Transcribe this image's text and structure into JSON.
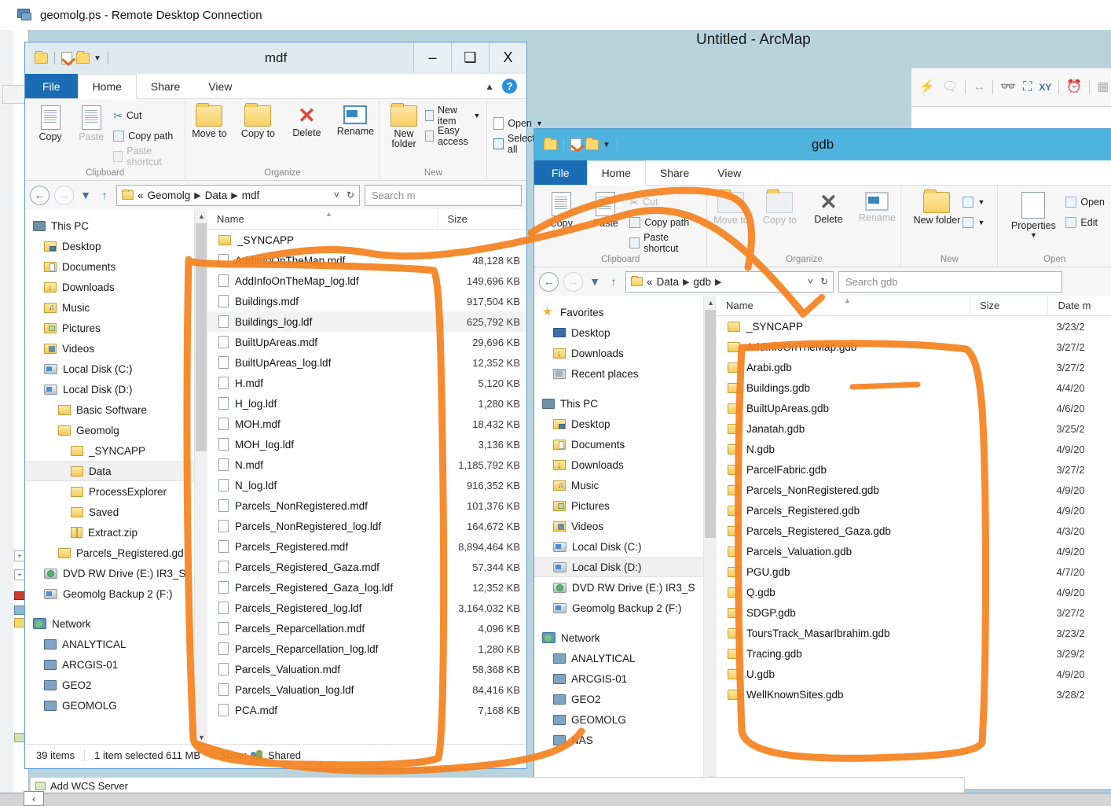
{
  "rdp": {
    "title": "geomolg.ps - Remote Desktop Connection",
    "icon": "remote-desktop-icon"
  },
  "arcmap": {
    "title": "Untitled - ArcMap",
    "bottom_item": "Add WCS Server",
    "toolbar_icons": [
      "lightning-icon",
      "callout-icon",
      "measure-icon",
      "binoculars-icon",
      "identify-icon",
      "xy-icon",
      "time-icon",
      "catalog-icon"
    ]
  },
  "window_controls": {
    "minimize": "–",
    "maximize": "❑",
    "close": "X"
  },
  "accent": {
    "active_title": "#4fb3e0",
    "inactive_title": "#dfe9ee",
    "file_tab": "#1c6cb5",
    "annotation": "#f58220"
  },
  "windows": [
    {
      "id": "mdf",
      "title": "mdf",
      "active": false,
      "tabs": [
        "File",
        "Home",
        "Share",
        "View"
      ],
      "selected_tab": "Home",
      "ribbon": {
        "groups": [
          {
            "label": "Clipboard",
            "big": [
              {
                "label": "Copy",
                "icon": "copy-icon",
                "disabled": false
              },
              {
                "label": "Paste",
                "icon": "paste-icon",
                "disabled": true
              }
            ],
            "small": [
              {
                "label": "Cut",
                "icon": "cut-icon",
                "disabled": false
              },
              {
                "label": "Copy path",
                "icon": "copy-path-icon",
                "disabled": false
              },
              {
                "label": "Paste shortcut",
                "icon": "paste-shortcut-icon",
                "disabled": true
              }
            ]
          },
          {
            "label": "Organize",
            "big": [
              {
                "label": "Move to",
                "icon": "move-to-icon",
                "disabled": false,
                "dropdown": true
              },
              {
                "label": "Copy to",
                "icon": "copy-to-icon",
                "disabled": false,
                "dropdown": true
              },
              {
                "label": "Delete",
                "icon": "delete-icon",
                "disabled": false,
                "dropdown": true
              },
              {
                "label": "Rename",
                "icon": "rename-icon",
                "disabled": false
              }
            ],
            "small": []
          },
          {
            "label": "New",
            "big": [
              {
                "label": "New folder",
                "icon": "new-folder-icon",
                "disabled": false
              }
            ],
            "small": [
              {
                "label": "New item",
                "icon": "new-item-icon",
                "disabled": false,
                "dropdown": true
              },
              {
                "label": "Easy access",
                "icon": "easy-access-icon",
                "disabled": false,
                "dropdown": true
              }
            ]
          },
          {
            "label": "",
            "big": [],
            "small": [
              {
                "label": "Open",
                "icon": "open-icon",
                "disabled": false,
                "dropdown": true
              },
              {
                "label": "Select all",
                "icon": "select-all-icon",
                "disabled": false
              }
            ]
          }
        ]
      },
      "address": {
        "crumbs": [
          "«",
          "Geomolg",
          "Data",
          "mdf"
        ],
        "search_placeholder": "Search m"
      },
      "nav": [
        {
          "label": "This PC",
          "icon": "this-pc-icon",
          "indent": 0
        },
        {
          "label": "Desktop",
          "icon": "desktop-folder-icon",
          "indent": 1
        },
        {
          "label": "Documents",
          "icon": "documents-folder-icon",
          "indent": 1
        },
        {
          "label": "Downloads",
          "icon": "downloads-folder-icon",
          "indent": 1
        },
        {
          "label": "Music",
          "icon": "music-folder-icon",
          "indent": 1
        },
        {
          "label": "Pictures",
          "icon": "pictures-folder-icon",
          "indent": 1
        },
        {
          "label": "Videos",
          "icon": "videos-folder-icon",
          "indent": 1
        },
        {
          "label": "Local Disk (C:)",
          "icon": "drive-icon",
          "indent": 1
        },
        {
          "label": "Local Disk (D:)",
          "icon": "drive-icon",
          "indent": 1
        },
        {
          "label": "Basic Software",
          "icon": "folder-icon",
          "indent": 2
        },
        {
          "label": "Geomolg",
          "icon": "folder-icon",
          "indent": 2
        },
        {
          "label": "_SYNCAPP",
          "icon": "folder-icon",
          "indent": 3
        },
        {
          "label": "Data",
          "icon": "folder-icon",
          "indent": 3,
          "selected": true
        },
        {
          "label": "ProcessExplorer",
          "icon": "folder-icon",
          "indent": 3
        },
        {
          "label": "Saved",
          "icon": "folder-icon",
          "indent": 3
        },
        {
          "label": "Extract.zip",
          "icon": "zip-icon",
          "indent": 3
        },
        {
          "label": "Parcels_Registered.gd",
          "icon": "folder-icon",
          "indent": 2
        },
        {
          "label": "DVD RW Drive (E:) IR3_S",
          "icon": "dvd-drive-icon",
          "indent": 1
        },
        {
          "label": "Geomolg Backup 2 (F:)",
          "icon": "drive-icon",
          "indent": 1
        },
        {
          "label": "",
          "icon": "spacer",
          "indent": 0
        },
        {
          "label": "Network",
          "icon": "network-icon",
          "indent": 0
        },
        {
          "label": "ANALYTICAL",
          "icon": "computer-icon",
          "indent": 1
        },
        {
          "label": "ARCGIS-01",
          "icon": "computer-icon",
          "indent": 1
        },
        {
          "label": "GEO2",
          "icon": "computer-icon",
          "indent": 1
        },
        {
          "label": "GEOMOLG",
          "icon": "computer-icon",
          "indent": 1
        }
      ],
      "columns": [
        "Name",
        "Size"
      ],
      "files": [
        {
          "name": "_SYNCAPP",
          "size": "",
          "icon": "folder-icon"
        },
        {
          "name": "AddInfoOnTheMap.mdf",
          "size": "48,128 KB",
          "icon": "file-icon"
        },
        {
          "name": "AddInfoOnTheMap_log.ldf",
          "size": "149,696 KB",
          "icon": "file-icon"
        },
        {
          "name": "Buildings.mdf",
          "size": "917,504 KB",
          "icon": "file-icon"
        },
        {
          "name": "Buildings_log.ldf",
          "size": "625,792 KB",
          "icon": "file-icon",
          "selected": true
        },
        {
          "name": "BuiltUpAreas.mdf",
          "size": "29,696 KB",
          "icon": "file-icon"
        },
        {
          "name": "BuiltUpAreas_log.ldf",
          "size": "12,352 KB",
          "icon": "file-icon"
        },
        {
          "name": "H.mdf",
          "size": "5,120 KB",
          "icon": "file-icon"
        },
        {
          "name": "H_log.ldf",
          "size": "1,280 KB",
          "icon": "file-icon"
        },
        {
          "name": "MOH.mdf",
          "size": "18,432 KB",
          "icon": "file-icon"
        },
        {
          "name": "MOH_log.ldf",
          "size": "3,136 KB",
          "icon": "file-icon"
        },
        {
          "name": "N.mdf",
          "size": "1,185,792 KB",
          "icon": "file-icon"
        },
        {
          "name": "N_log.ldf",
          "size": "916,352 KB",
          "icon": "file-icon"
        },
        {
          "name": "Parcels_NonRegistered.mdf",
          "size": "101,376 KB",
          "icon": "file-icon"
        },
        {
          "name": "Parcels_NonRegistered_log.ldf",
          "size": "164,672 KB",
          "icon": "file-icon"
        },
        {
          "name": "Parcels_Registered.mdf",
          "size": "8,894,464 KB",
          "icon": "file-icon"
        },
        {
          "name": "Parcels_Registered_Gaza.mdf",
          "size": "57,344 KB",
          "icon": "file-icon"
        },
        {
          "name": "Parcels_Registered_Gaza_log.ldf",
          "size": "12,352 KB",
          "icon": "file-icon"
        },
        {
          "name": "Parcels_Registered_log.ldf",
          "size": "3,164,032 KB",
          "icon": "file-icon"
        },
        {
          "name": "Parcels_Reparcellation.mdf",
          "size": "4,096 KB",
          "icon": "file-icon"
        },
        {
          "name": "Parcels_Reparcellation_log.ldf",
          "size": "1,280 KB",
          "icon": "file-icon"
        },
        {
          "name": "Parcels_Valuation.mdf",
          "size": "58,368 KB",
          "icon": "file-icon"
        },
        {
          "name": "Parcels_Valuation_log.ldf",
          "size": "84,416 KB",
          "icon": "file-icon"
        },
        {
          "name": "PCA.mdf",
          "size": "7,168 KB",
          "icon": "file-icon"
        }
      ],
      "status": {
        "count": "39 items",
        "selection": "1 item selected  611 MB",
        "state_label": "State:",
        "state_value": "Shared"
      }
    },
    {
      "id": "gdb",
      "title": "gdb",
      "active": true,
      "tabs": [
        "File",
        "Home",
        "Share",
        "View"
      ],
      "selected_tab": "Home",
      "ribbon": {
        "groups": [
          {
            "label": "Clipboard",
            "big": [
              {
                "label": "Copy",
                "icon": "copy-icon",
                "disabled": false
              },
              {
                "label": "Paste",
                "icon": "paste-icon",
                "disabled": false
              }
            ],
            "small": [
              {
                "label": "Cut",
                "icon": "cut-icon",
                "disabled": true
              },
              {
                "label": "Copy path",
                "icon": "copy-path-icon",
                "disabled": false
              },
              {
                "label": "Paste shortcut",
                "icon": "paste-shortcut-icon",
                "disabled": false
              }
            ]
          },
          {
            "label": "Organize",
            "big": [
              {
                "label": "Move to",
                "icon": "move-to-icon",
                "disabled": true,
                "dropdown": true
              },
              {
                "label": "Copy to",
                "icon": "copy-to-icon",
                "disabled": true,
                "dropdown": true
              },
              {
                "label": "Delete",
                "icon": "delete-icon",
                "disabled": false,
                "dropdown": true
              },
              {
                "label": "Rename",
                "icon": "rename-icon",
                "disabled": true
              }
            ],
            "small": []
          },
          {
            "label": "New",
            "big": [
              {
                "label": "New folder",
                "icon": "new-folder-icon",
                "disabled": false
              }
            ],
            "small": [
              {
                "label": "",
                "icon": "new-item-icon",
                "disabled": false,
                "dropdown": true
              },
              {
                "label": "",
                "icon": "easy-access-icon",
                "disabled": false,
                "dropdown": true
              }
            ]
          },
          {
            "label": "Open",
            "big": [
              {
                "label": "Properties",
                "icon": "properties-icon",
                "disabled": false,
                "dropdown": true
              }
            ],
            "small": [
              {
                "label": "Open",
                "icon": "open-icon",
                "disabled": false
              },
              {
                "label": "Edit",
                "icon": "edit-icon",
                "disabled": false
              }
            ]
          }
        ]
      },
      "address": {
        "crumbs": [
          "«",
          "Data",
          "gdb",
          ""
        ],
        "search_placeholder": "Search gdb"
      },
      "nav": [
        {
          "label": "Favorites",
          "icon": "star-icon",
          "indent": 0
        },
        {
          "label": "Desktop",
          "icon": "desktop-icon",
          "indent": 1
        },
        {
          "label": "Downloads",
          "icon": "downloads-folder-icon",
          "indent": 1
        },
        {
          "label": "Recent places",
          "icon": "recent-places-icon",
          "indent": 1
        },
        {
          "label": "",
          "icon": "spacer",
          "indent": 0
        },
        {
          "label": "This PC",
          "icon": "this-pc-icon",
          "indent": 0
        },
        {
          "label": "Desktop",
          "icon": "desktop-folder-icon",
          "indent": 1
        },
        {
          "label": "Documents",
          "icon": "documents-folder-icon",
          "indent": 1
        },
        {
          "label": "Downloads",
          "icon": "downloads-folder-icon",
          "indent": 1
        },
        {
          "label": "Music",
          "icon": "music-folder-icon",
          "indent": 1
        },
        {
          "label": "Pictures",
          "icon": "pictures-folder-icon",
          "indent": 1
        },
        {
          "label": "Videos",
          "icon": "videos-folder-icon",
          "indent": 1
        },
        {
          "label": "Local Disk (C:)",
          "icon": "drive-icon",
          "indent": 1
        },
        {
          "label": "Local Disk (D:)",
          "icon": "drive-icon",
          "indent": 1,
          "selected": true
        },
        {
          "label": "DVD RW Drive (E:) IR3_S",
          "icon": "dvd-drive-icon",
          "indent": 1
        },
        {
          "label": "Geomolg Backup 2 (F:)",
          "icon": "drive-icon",
          "indent": 1
        },
        {
          "label": "",
          "icon": "spacer",
          "indent": 0
        },
        {
          "label": "Network",
          "icon": "network-icon",
          "indent": 0
        },
        {
          "label": "ANALYTICAL",
          "icon": "computer-icon",
          "indent": 1
        },
        {
          "label": "ARCGIS-01",
          "icon": "computer-icon",
          "indent": 1
        },
        {
          "label": "GEO2",
          "icon": "computer-icon",
          "indent": 1
        },
        {
          "label": "GEOMOLG",
          "icon": "computer-icon",
          "indent": 1
        },
        {
          "label": "NAS",
          "icon": "computer-icon",
          "indent": 1
        }
      ],
      "columns": [
        "Name",
        "Size",
        "Date m"
      ],
      "files": [
        {
          "name": "_SYNCAPP",
          "size": "",
          "date": "3/23/2",
          "icon": "folder-icon"
        },
        {
          "name": "AddInfoOnTheMap.gdb",
          "size": "",
          "date": "3/27/2",
          "icon": "folder-icon"
        },
        {
          "name": "Arabi.gdb",
          "size": "",
          "date": "3/27/2",
          "icon": "folder-icon"
        },
        {
          "name": "Buildings.gdb",
          "size": "",
          "date": "4/4/20",
          "icon": "folder-icon"
        },
        {
          "name": "BuiltUpAreas.gdb",
          "size": "",
          "date": "4/6/20",
          "icon": "folder-icon"
        },
        {
          "name": "Janatah.gdb",
          "size": "",
          "date": "3/25/2",
          "icon": "folder-icon"
        },
        {
          "name": "N.gdb",
          "size": "",
          "date": "4/9/20",
          "icon": "folder-icon"
        },
        {
          "name": "ParcelFabric.gdb",
          "size": "",
          "date": "3/27/2",
          "icon": "folder-icon"
        },
        {
          "name": "Parcels_NonRegistered.gdb",
          "size": "",
          "date": "4/9/20",
          "icon": "folder-icon"
        },
        {
          "name": "Parcels_Registered.gdb",
          "size": "",
          "date": "4/9/20",
          "icon": "folder-icon"
        },
        {
          "name": "Parcels_Registered_Gaza.gdb",
          "size": "",
          "date": "4/3/20",
          "icon": "folder-icon"
        },
        {
          "name": "Parcels_Valuation.gdb",
          "size": "",
          "date": "4/9/20",
          "icon": "folder-icon"
        },
        {
          "name": "PGU.gdb",
          "size": "",
          "date": "4/7/20",
          "icon": "folder-icon"
        },
        {
          "name": "Q.gdb",
          "size": "",
          "date": "4/9/20",
          "icon": "folder-icon"
        },
        {
          "name": "SDGP.gdb",
          "size": "",
          "date": "3/27/2",
          "icon": "folder-icon"
        },
        {
          "name": "ToursTrack_MasarIbrahim.gdb",
          "size": "",
          "date": "3/23/2",
          "icon": "folder-icon"
        },
        {
          "name": "Tracing.gdb",
          "size": "",
          "date": "3/29/2",
          "icon": "folder-icon"
        },
        {
          "name": "U.gdb",
          "size": "",
          "date": "4/9/20",
          "icon": "folder-icon"
        },
        {
          "name": "WellKnownSites.gdb",
          "size": "",
          "date": "3/28/2",
          "icon": "folder-icon"
        }
      ]
    }
  ],
  "annotations": {
    "color": "#f58220",
    "description": "hand-drawn orange marker strokes circling the mdf file list and the gdb file list, plus an arrow from the mdf list to the gdb list"
  }
}
